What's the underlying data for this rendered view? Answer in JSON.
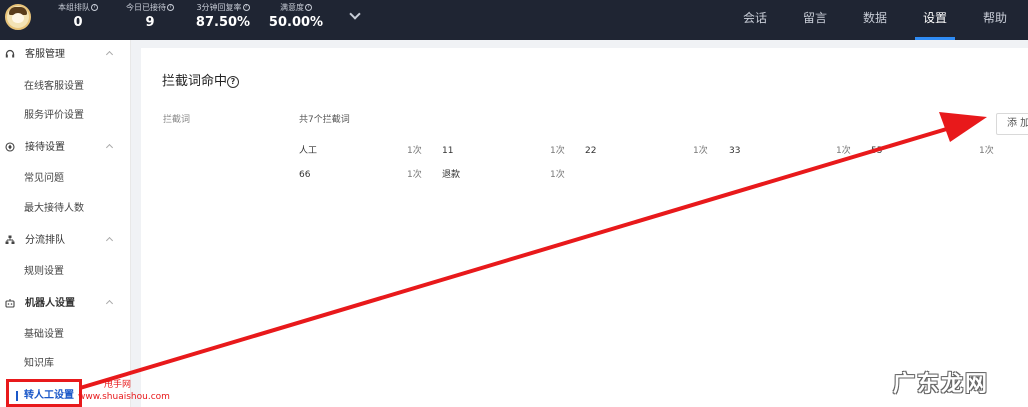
{
  "header": {
    "stats": [
      {
        "label": "本组排队",
        "value": "0"
      },
      {
        "label": "今日已接待",
        "value": "9"
      },
      {
        "label": "3分钟回复率",
        "value": "87.50%"
      },
      {
        "label": "满意度",
        "value": "50.00%"
      }
    ],
    "nav": [
      "会话",
      "留言",
      "数据",
      "设置",
      "帮助"
    ],
    "active_nav": "设置",
    "accent_color": "#2f8cf5",
    "bg_color": "#1f2533"
  },
  "sidebar": {
    "groups": [
      {
        "label": "客服管理",
        "icon": "headset-icon",
        "items": [
          "在线客服设置",
          "服务评价设置"
        ]
      },
      {
        "label": "接待设置",
        "icon": "reception-icon",
        "items": [
          "常见问题",
          "最大接待人数"
        ]
      },
      {
        "label": "分流排队",
        "icon": "org-tree-icon",
        "items": [
          "规则设置"
        ]
      },
      {
        "label": "机器人设置",
        "icon": "robot-icon",
        "items": [
          "基础设置",
          "知识库",
          "转人工设置"
        ]
      }
    ],
    "active_item": "转人工设置"
  },
  "main": {
    "title": "拦截词命中",
    "field_label": "拦截词",
    "count_text": "共7个拦截词",
    "add_button": "添 加",
    "keywords": [
      {
        "word": "人工",
        "count": "1次"
      },
      {
        "word": "11",
        "count": "1次"
      },
      {
        "word": "22",
        "count": "1次"
      },
      {
        "word": "33",
        "count": "1次"
      },
      {
        "word": "55",
        "count": "1次"
      },
      {
        "word": "66",
        "count": "1次"
      },
      {
        "word": "退款",
        "count": "1次"
      }
    ]
  },
  "annotations": {
    "watermark_cn": "甩手网",
    "watermark_url": "www.shuaishou.com",
    "watermark_corner": "广东龙网",
    "annotation_color": "#e8191b"
  }
}
